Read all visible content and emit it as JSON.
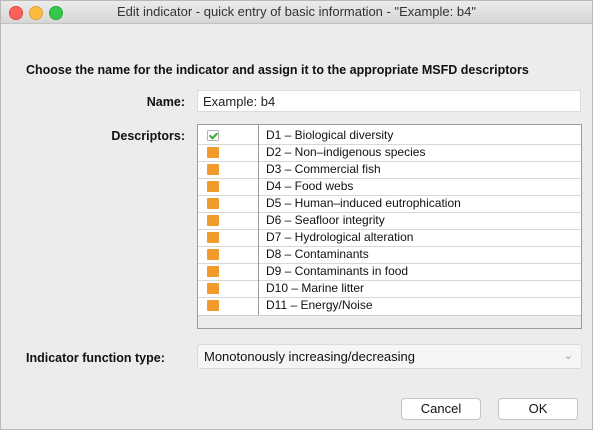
{
  "window": {
    "title": "Edit indicator - quick entry of basic information - \"Example: b4\""
  },
  "form": {
    "heading": "Choose the name for the indicator and assign it to the appropriate MSFD descriptors",
    "name_label": "Name:",
    "name_value": "Example: b4",
    "descriptors_label": "Descriptors:",
    "descriptors": [
      {
        "label": "D1 – Biological diversity",
        "checked": true
      },
      {
        "label": "D2 – Non–indigenous species",
        "checked": false
      },
      {
        "label": "D3 – Commercial fish",
        "checked": false
      },
      {
        "label": "D4 – Food webs",
        "checked": false
      },
      {
        "label": "D5 – Human–induced eutrophication",
        "checked": false
      },
      {
        "label": "D6 – Seafloor integrity",
        "checked": false
      },
      {
        "label": "D7 – Hydrological alteration",
        "checked": false
      },
      {
        "label": "D8 – Contaminants",
        "checked": false
      },
      {
        "label": "D9 – Contaminants in food",
        "checked": false
      },
      {
        "label": "D10 – Marine litter",
        "checked": false
      },
      {
        "label": "D11 – Energy/Noise",
        "checked": false
      }
    ],
    "function_type_label": "Indicator function type:",
    "function_type_value": "Monotonously increasing/decreasing"
  },
  "buttons": {
    "cancel": "Cancel",
    "ok": "OK"
  },
  "colors": {
    "unchecked_box": "#f09b2c",
    "check_mark": "#3aa83a"
  },
  "icons": {
    "close": "close-icon",
    "minimize": "minimize-icon",
    "maximize": "maximize-icon",
    "dropdown": "chevron-down-icon",
    "checkmark": "checkmark-icon"
  }
}
